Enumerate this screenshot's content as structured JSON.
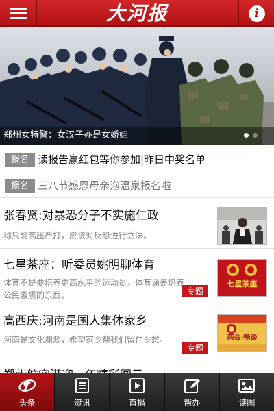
{
  "header": {
    "logo_text": "大河报",
    "menu_icon": "menu-icon",
    "info_icon": "info-icon",
    "info_glyph": "i",
    "brand_color": "#c41a1d"
  },
  "banner": {
    "caption": "郑州女特警：女汉子亦是女娇娃",
    "slide_count": 2,
    "active_slide": 1
  },
  "notices": [
    {
      "badge": "报名",
      "text": "读报告赢红包等你参加|昨日中奖名单"
    },
    {
      "badge": "报名",
      "text": "三八节感恩母亲泡温泉报名啦"
    }
  ],
  "articles": [
    {
      "title": "张春贤:对暴恐分子不实施仁政",
      "summary": "称只能高压严打，应该对反恐进行立法。",
      "tag": ""
    },
    {
      "title": "七星茶座：听委员姚明聊体育",
      "summary": "体育不是要培养更高水平的运动员，体育涵盖培养公民素质的东西。",
      "tag": "专题"
    },
    {
      "title": "高西庆:河南是国人集体家乡",
      "summary": "河南是文化渊源，希望家乡帮我们留住乡愁。",
      "tag": "专题"
    }
  ],
  "thumbs": [
    {
      "text": ""
    },
    {
      "text": "七星茶座"
    },
    {
      "text": "两会·畅谈"
    }
  ],
  "partial_article_title": "郑州航空港迎一年精彩图示",
  "tabbar": {
    "active_color": "#b51316",
    "items": [
      {
        "label": "头条",
        "icon": "headline-icon",
        "active": true
      },
      {
        "label": "资讯",
        "icon": "news-icon",
        "active": false
      },
      {
        "label": "直播",
        "icon": "live-play-icon",
        "active": false
      },
      {
        "label": "帮办",
        "icon": "edit-icon",
        "active": false
      },
      {
        "label": "读图",
        "icon": "picture-icon",
        "active": false
      }
    ]
  }
}
